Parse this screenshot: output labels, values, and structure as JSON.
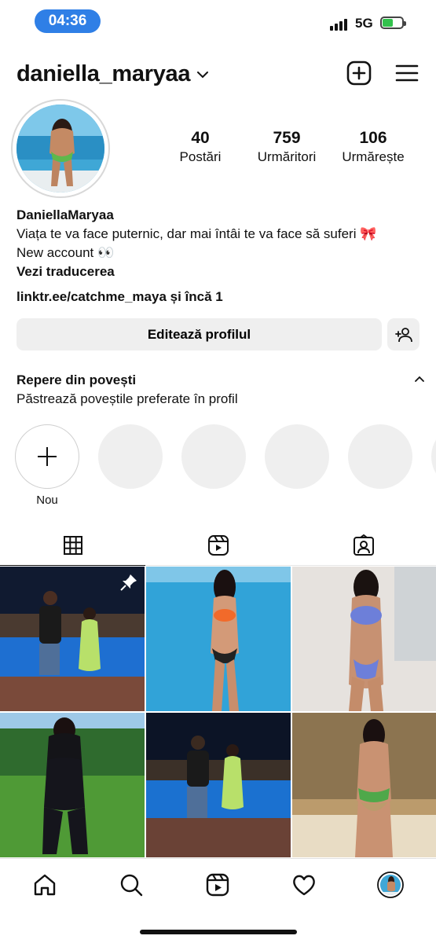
{
  "status_bar": {
    "time": "04:36",
    "network": "5G"
  },
  "header": {
    "username": "daniella_maryaa"
  },
  "profile": {
    "stats": [
      {
        "value": "40",
        "label": "Postări"
      },
      {
        "value": "759",
        "label": "Urmăritori"
      },
      {
        "value": "106",
        "label": "Urmărește"
      }
    ],
    "display_name": "DaniellaMaryaa",
    "bio_line1": "Viața te va face puternic, dar mai întâi te va face să suferi 🎀",
    "bio_line2": "New account 👀",
    "translate": "Vezi traducerea",
    "link": "linktr.ee/catchme_maya și încă 1"
  },
  "actions": {
    "edit_profile": "Editează profilul"
  },
  "highlights": {
    "title": "Repere din povești",
    "subtitle": "Păstrează poveștile preferate în profil",
    "new_label": "Nou"
  },
  "colors": {
    "accent": "#2f7fe6",
    "battery": "#33c24d",
    "button_bg": "#efefef"
  }
}
